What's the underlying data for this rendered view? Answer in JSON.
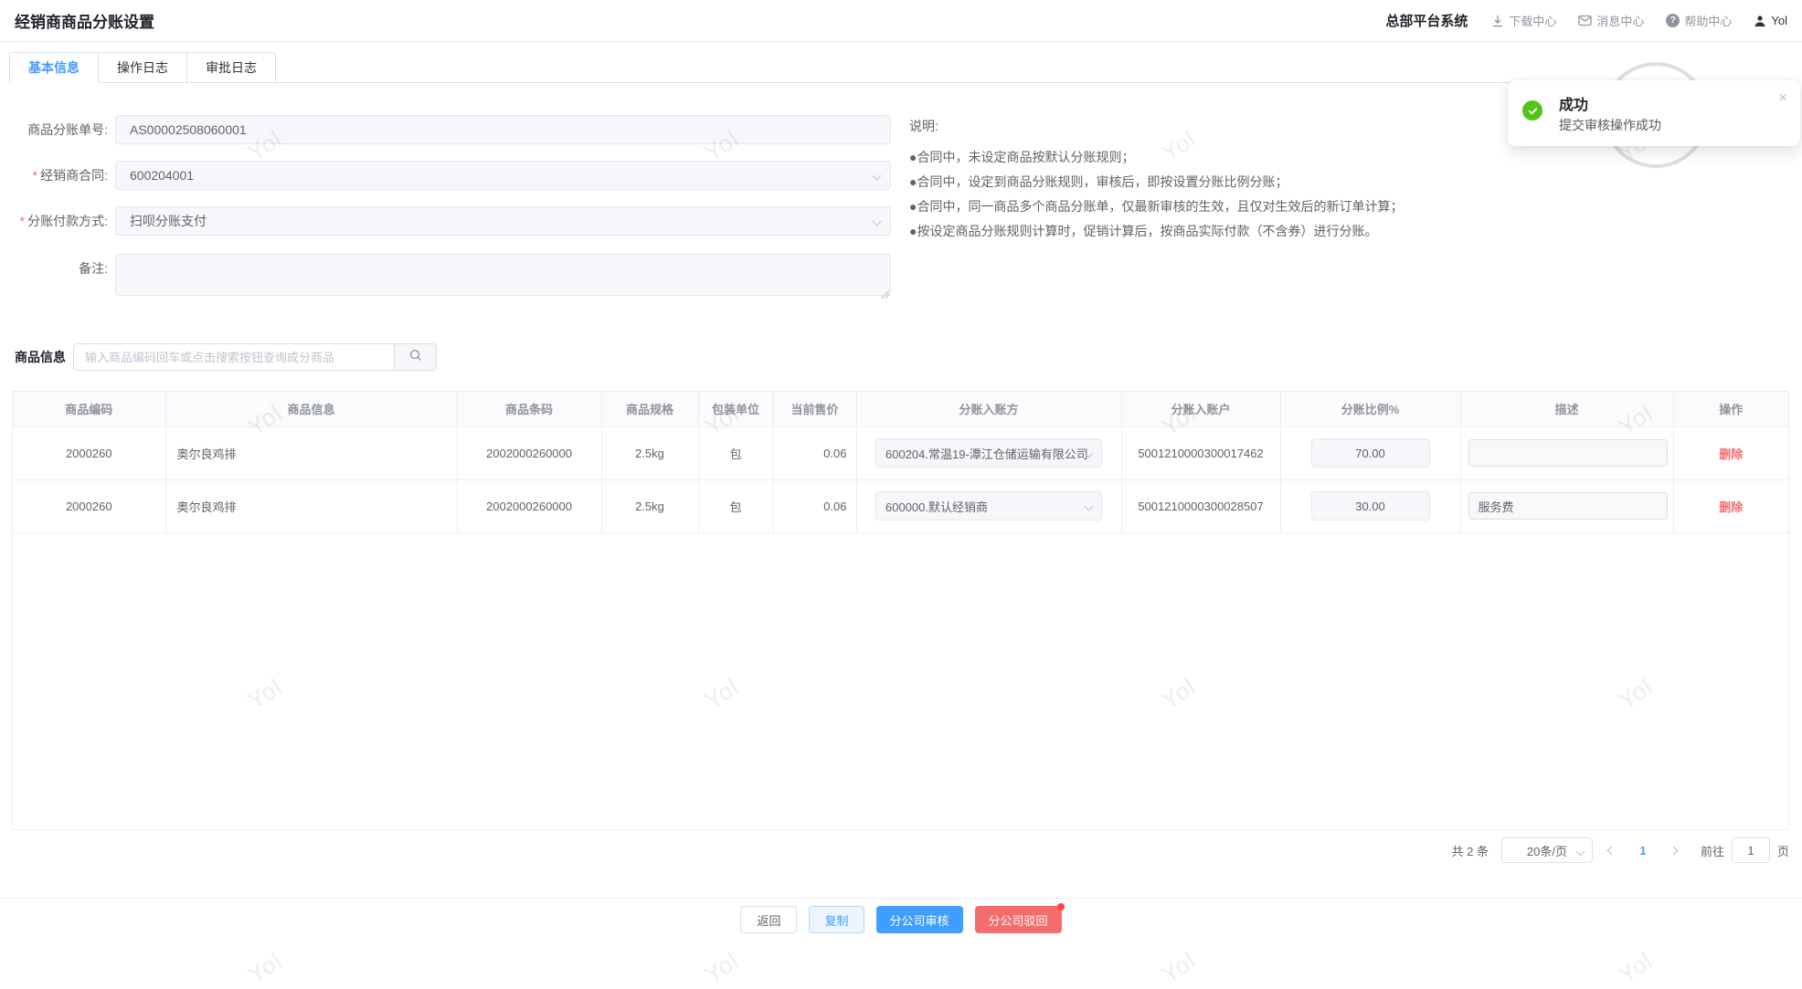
{
  "page": {
    "title": "经销商商品分账设置"
  },
  "header": {
    "system_name": "总部平台系统",
    "nav_items": [
      {
        "icon": "download-icon",
        "label": "下载中心"
      },
      {
        "icon": "mail-icon",
        "label": "消息中心"
      },
      {
        "icon": "help-icon",
        "label": "帮助中心"
      },
      {
        "icon": "user-icon",
        "label": "Yol"
      }
    ]
  },
  "tabs": [
    {
      "label": "基本信息"
    },
    {
      "label": "操作日志"
    },
    {
      "label": "审批日志"
    }
  ],
  "form": {
    "required_mark": "*",
    "order_no": {
      "label": "商品分账单号:",
      "value": "AS00002508060001"
    },
    "contract": {
      "label": "经销商合同:",
      "value": "600204001"
    },
    "pay_method": {
      "label": "分账付款方式:",
      "value": "扫呗分账支付"
    },
    "remark": {
      "label": "备注:",
      "value": ""
    }
  },
  "notes": {
    "title": "说明:",
    "items": [
      "●合同中，未设定商品按默认分账规则；",
      "●合同中，设定到商品分账规则，审核后，即按设置分账比例分账；",
      "●合同中，同一商品多个商品分账单，仅最新审核的生效，且仅对生效后的新订单计算；",
      "●按设定商品分账规则计算时，促销计算后，按商品实际付款（不含券）进行分账。"
    ]
  },
  "toast": {
    "title": "成功",
    "message": "提交审核操作成功",
    "close": "×"
  },
  "product_section": {
    "label": "商品信息",
    "search_placeholder": "输入商品编码回车或点击搜索按钮查询成分商品"
  },
  "table": {
    "columns": [
      "商品编码",
      "商品信息",
      "商品条码",
      "商品规格",
      "包装单位",
      "当前售价",
      "分账入账方",
      "分账入账户",
      "分账比例%",
      "描述",
      "操作"
    ],
    "action_label": "删除",
    "rows": [
      {
        "code": "2000260",
        "name": "奥尔良鸡排",
        "barcode": "2002000260000",
        "spec": "2.5kg",
        "unit": "包",
        "price": "0.06",
        "party": "600204.常温19-潭江仓储运输有限公司",
        "account": "5001210000300017462",
        "ratio": "70.00",
        "desc": ""
      },
      {
        "code": "2000260",
        "name": "奥尔良鸡排",
        "barcode": "2002000260000",
        "spec": "2.5kg",
        "unit": "包",
        "price": "0.06",
        "party": "600000.默认经销商",
        "account": "5001210000300028507",
        "ratio": "30.00",
        "desc": "服务费"
      }
    ]
  },
  "pagination": {
    "total": "共 2 条",
    "page_size": "20条/页",
    "current_page": "1",
    "goto_label": "前往",
    "goto_value": "1",
    "unit_label": "页"
  },
  "footer": {
    "back": "返回",
    "copy": "复制",
    "audit": "分公司审核",
    "reject": "分公司驳回"
  },
  "watermark": {
    "text": "Yol"
  },
  "colors": {
    "primary": "#409eff",
    "danger": "#f56c6c",
    "success": "#52c41a"
  }
}
